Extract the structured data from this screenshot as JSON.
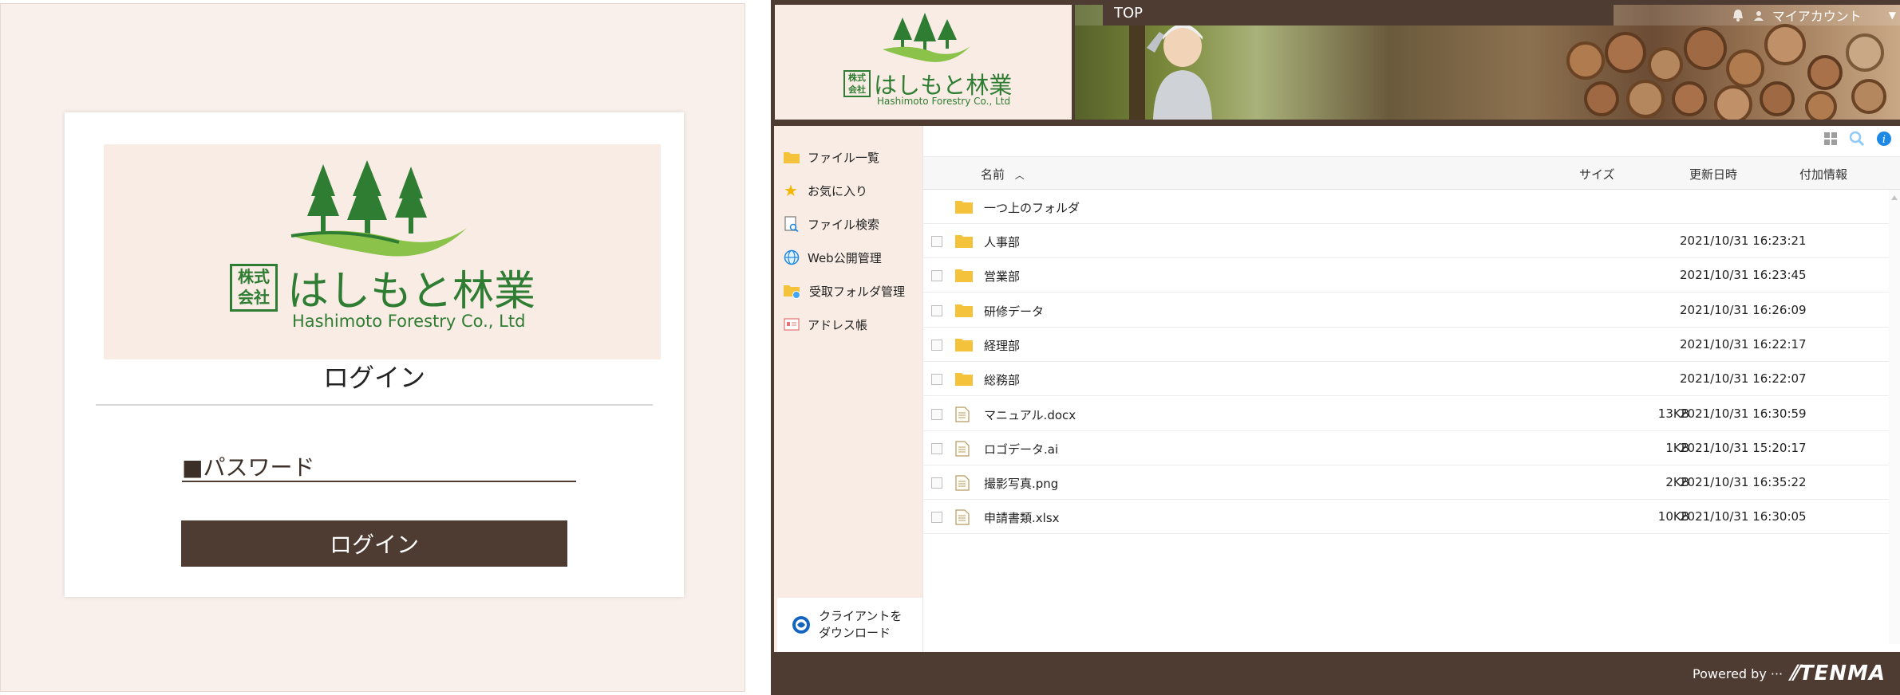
{
  "login": {
    "logo_kabushiki": "株式\n会社",
    "logo_company_jp": "はしもと林業",
    "logo_company_en": "Hashimoto Forestry Co., Ltd",
    "title": "ログイン",
    "password_label": "■パスワード",
    "login_button": "ログイン"
  },
  "file_manager": {
    "header": {
      "logo_company_jp": "はしもと林業",
      "logo_company_en": "Hashimoto Forestry Co., Ltd",
      "top_label": "TOP",
      "account_label": "マイアカウント"
    },
    "sidebar": {
      "items": [
        {
          "label": "ファイル一覧",
          "icon": "folder-icon"
        },
        {
          "label": "お気に入り",
          "icon": "star-icon"
        },
        {
          "label": "ファイル検索",
          "icon": "file-search-icon"
        },
        {
          "label": "Web公開管理",
          "icon": "globe-icon"
        },
        {
          "label": "受取フォルダ管理",
          "icon": "receive-folder-icon"
        },
        {
          "label": "アドレス帳",
          "icon": "address-book-icon"
        }
      ],
      "client_download": "クライアントを\nダウンロード"
    },
    "columns": {
      "name": "名前",
      "size": "サイズ",
      "modified": "更新日時",
      "info": "付加情報"
    },
    "parent_folder": "一つ上のフォルダ",
    "rows": [
      {
        "name": "人事部",
        "type": "folder",
        "size": "",
        "modified": "2021/10/31 16:23:21"
      },
      {
        "name": "営業部",
        "type": "folder",
        "size": "",
        "modified": "2021/10/31 16:23:45"
      },
      {
        "name": "研修データ",
        "type": "folder",
        "size": "",
        "modified": "2021/10/31 16:26:09"
      },
      {
        "name": "経理部",
        "type": "folder",
        "size": "",
        "modified": "2021/10/31 16:22:17"
      },
      {
        "name": "総務部",
        "type": "folder",
        "size": "",
        "modified": "2021/10/31 16:22:07"
      },
      {
        "name": "マニュアル.docx",
        "type": "file",
        "size": "13KB",
        "modified": "2021/10/31 16:30:59"
      },
      {
        "name": "ロゴデータ.ai",
        "type": "file",
        "size": "1KB",
        "modified": "2021/10/31 15:20:17"
      },
      {
        "name": "撮影写真.png",
        "type": "file",
        "size": "2KB",
        "modified": "2021/10/31 16:35:22"
      },
      {
        "name": "申請書類.xlsx",
        "type": "file",
        "size": "10KB",
        "modified": "2021/10/31 16:30:05"
      }
    ],
    "footer": {
      "powered_by": "Powered by ···",
      "brand": "TENMA"
    }
  },
  "colors": {
    "brand_brown": "#4e3b31",
    "cream_bg": "#f9ece5",
    "tree_green": "#2e7d32",
    "folder_yellow": "#f5c33b",
    "accent_blue": "#1e88e5"
  }
}
